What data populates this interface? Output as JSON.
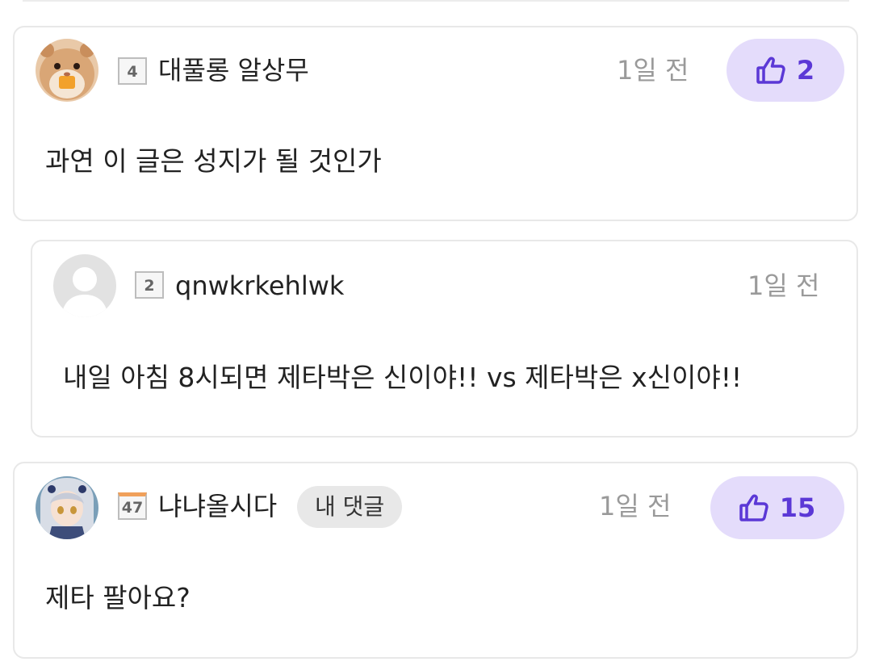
{
  "comments": [
    {
      "level": "4",
      "nickname": "대풀롱 알상무",
      "time": "1일 전",
      "likes": "2",
      "text": "과연 이 글은 성지가 될 것인가",
      "avatar_icon": "hamster-avatar"
    },
    {
      "level": "2",
      "nickname": "qnwkrkehlwk",
      "time": "1일 전",
      "text": "내일 아침 8시되면 제타박은 신이야!! vs 제타박은 x신이야!!",
      "avatar_icon": "default-user-avatar"
    },
    {
      "level": "47",
      "nickname": "냐냐올시다",
      "tag": "내 댓글",
      "time": "1일 전",
      "likes": "15",
      "text": "제타 팔아요?",
      "avatar_icon": "anime-girl-avatar"
    }
  ],
  "colors": {
    "like_bg": "#e4dcfb",
    "like_fg": "#5b38d6",
    "time": "#9a9a9a",
    "card_border": "#e8e8e8"
  }
}
